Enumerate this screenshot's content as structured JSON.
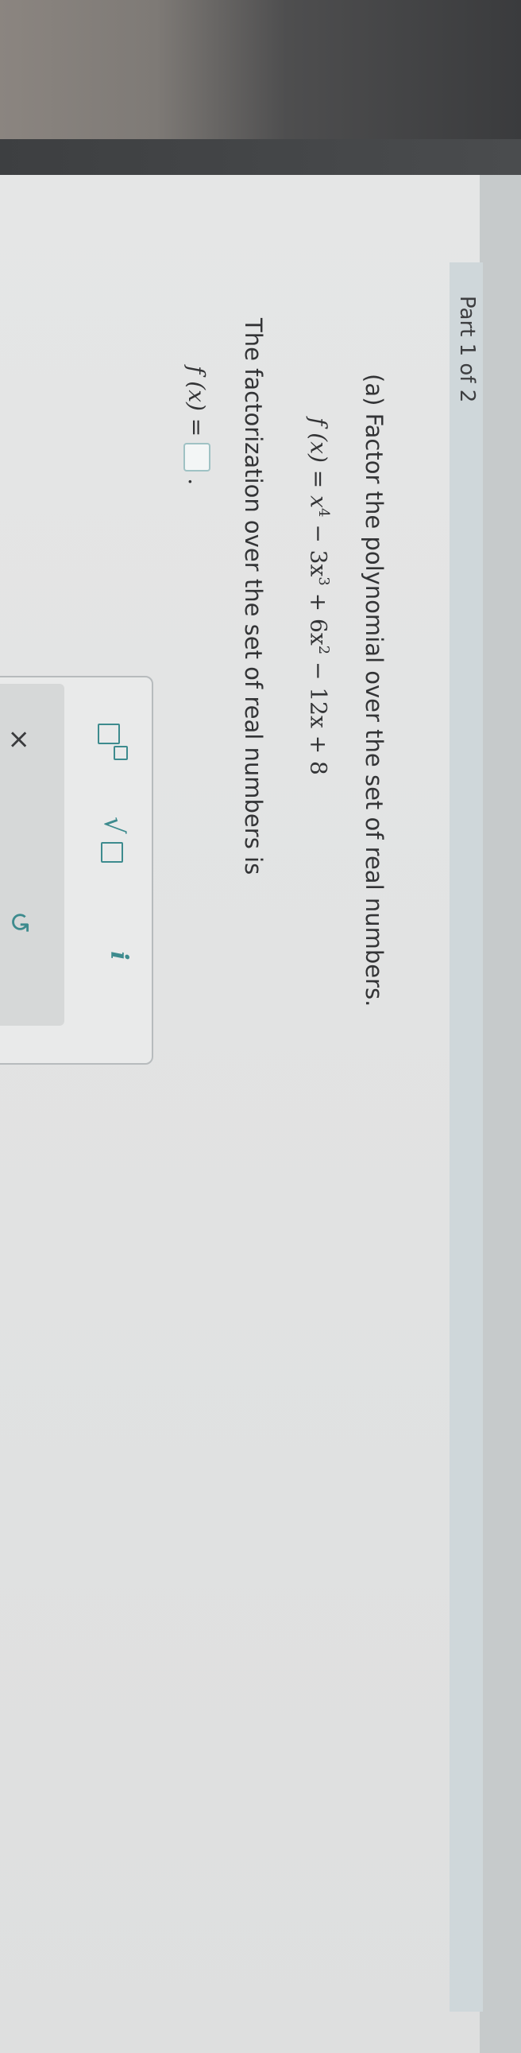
{
  "part": {
    "label": "Part 1 of 2"
  },
  "question": {
    "prompt": "(a) Factor the polynomial over the set of real numbers.",
    "function_name": "f (x) = ",
    "polynomial": {
      "t1": "x",
      "e1": "4",
      "t2": " − 3x",
      "e2": "3",
      "t3": " + 6x",
      "e3": "2",
      "t4": " − 12x + 8"
    },
    "statement": "The factorization over the set of real numbers is",
    "answer_label": "f (x) =",
    "answer_value": "",
    "answer_suffix": "."
  },
  "toolbar": {
    "buttons": [
      {
        "icon": "superscript-icon"
      },
      {
        "icon": "square-root-icon"
      },
      {
        "icon": "info-icon",
        "glyph": "i"
      }
    ],
    "actions": [
      {
        "icon": "close-icon",
        "glyph": "×"
      },
      {
        "icon": "undo-icon",
        "glyph": "↺"
      }
    ]
  },
  "colors": {
    "accent": "#3d8b8e",
    "header_band": "#cfd7da",
    "answer_border": "#9fc2c4"
  }
}
